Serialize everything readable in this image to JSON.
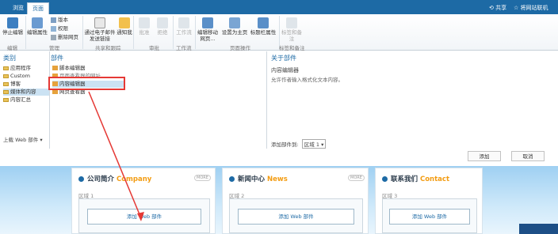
{
  "ribbon": {
    "tabs": [
      "浏览",
      "页面"
    ],
    "active_tab": "页面",
    "share_label": "共享",
    "sync_label": "将网站联机",
    "buttons": {
      "stop_edit": "停止编辑",
      "edit_props": "编辑属性",
      "version": "版本",
      "permissions": "权限",
      "delete_page": "删除网页",
      "email_link": "通过电子邮件发送链接",
      "alert_me": "通知我",
      "approve": "批准",
      "reject": "拒绝",
      "workflow": "工作流",
      "edit_mobile": "编辑移动网页...",
      "set_home": "设置为主页",
      "title_bar_props": "标题栏属性",
      "tags_notes": "标签和备注"
    },
    "groups": {
      "edit": "编辑",
      "manage": "管理",
      "share_track": "共享和跟踪",
      "approval": "审批",
      "workflow": "工作流",
      "page_actions": "页面操作",
      "tags_notes": "标签和备注"
    }
  },
  "panel": {
    "categories_header": "类别",
    "parts_header": "部件",
    "about_header": "关于部件",
    "categories": [
      "应用程序",
      "Custom",
      "博客",
      "媒体和内容",
      "内容汇总"
    ],
    "selected_category": "媒体和内容",
    "upload_label": "上载 Web 部件",
    "parts": [
      "脚本编辑器",
      "页面查看器的网址",
      "内容编辑器",
      "网页查看器"
    ],
    "selected_part": "内容编辑器",
    "about_title": "内容编辑器",
    "about_desc": "允许作者输入格式化文本内容。",
    "add_part_to_label": "添加部件到:",
    "zone_select_value": "区域 1",
    "add_button": "添加",
    "cancel_button": "取消"
  },
  "page": {
    "zones": [
      {
        "title_cn": "公司简介",
        "title_en": "Company",
        "zone_label": "区域 1",
        "add_web": "添加 Web 部件"
      },
      {
        "title_cn": "新闻中心",
        "title_en": "News",
        "zone_label": "区域 2",
        "add_web": "添加 Web 部件"
      },
      {
        "title_cn": "联系我们",
        "title_en": "Contact",
        "zone_label": "区域 3",
        "add_web": "添加 Web 部件"
      }
    ],
    "more_label": "MORE"
  },
  "colors": {
    "ribbon": "#1d6aa5",
    "highlight": "#e53935",
    "accent_en": "#f39c12"
  }
}
